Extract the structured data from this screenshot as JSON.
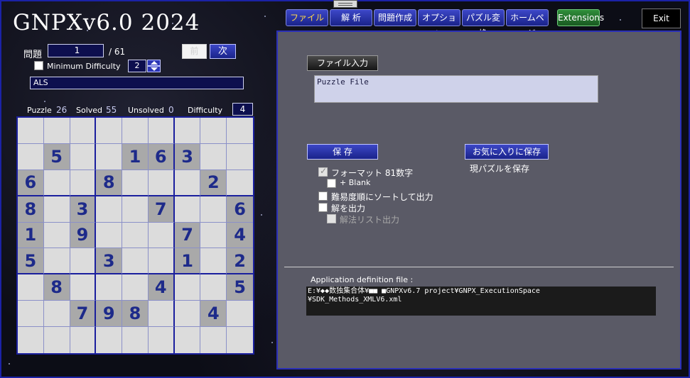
{
  "app": {
    "title": "GNPXv6.0 2024"
  },
  "nav": {
    "tabs": [
      "ファイル",
      "解 析",
      "問題作成",
      "オプション",
      "パズル変換",
      "ホームページ"
    ],
    "active": "ファイル",
    "extensions": "Extensions",
    "exit": "Exit"
  },
  "problem": {
    "label": "問題",
    "number": "1",
    "total": "/ 61",
    "prev": "前",
    "next": "次"
  },
  "min_difficulty": {
    "label": "Minimum Difficulty",
    "checked": false,
    "value": "2"
  },
  "method_name": "ALS",
  "stats": {
    "puzzle_label": "Puzzle",
    "puzzle_value": "26",
    "solved_label": "Solved",
    "solved_value": "55",
    "unsolved_label": "Unsolved",
    "unsolved_value": "0",
    "difficulty_label": "Difficulty",
    "difficulty_value": "4"
  },
  "board": [
    [
      "",
      "",
      "",
      "",
      "",
      "",
      "",
      "",
      ""
    ],
    [
      "",
      "5",
      "",
      "",
      "1",
      "6",
      "3",
      "",
      ""
    ],
    [
      "6",
      "",
      "",
      "8",
      "",
      "",
      "",
      "2",
      ""
    ],
    [
      "8",
      "",
      "3",
      "",
      "",
      "7",
      "",
      "",
      "6"
    ],
    [
      "1",
      "",
      "9",
      "",
      "",
      "",
      "7",
      "",
      "4"
    ],
    [
      "5",
      "",
      "",
      "3",
      "",
      "",
      "1",
      "",
      "2"
    ],
    [
      "",
      "8",
      "",
      "",
      "",
      "4",
      "",
      "",
      "5"
    ],
    [
      "",
      "",
      "7",
      "9",
      "8",
      "",
      "",
      "4",
      ""
    ],
    [
      "",
      "",
      "",
      "",
      "",
      "",
      "",
      "",
      ""
    ]
  ],
  "file_panel": {
    "file_input_button": "ファイル入力",
    "file_area_text": "Puzzle File",
    "save_button": "保 存",
    "favorite_button": "お気に入りに保存",
    "favorite_desc": "現パズルを保存",
    "options": {
      "format81": {
        "label": "フォーマット 81数字",
        "checked": true,
        "disabled": true
      },
      "blank": {
        "label": "+ Blank",
        "checked": false,
        "disabled": false
      },
      "sort_by_difficulty": {
        "label": "難易度順にソートして出力",
        "checked": false,
        "disabled": false
      },
      "output_solution": {
        "label": "解を出力",
        "checked": false,
        "disabled": false
      },
      "method_list": {
        "label": "解法リスト出力",
        "checked": false,
        "disabled": true
      }
    },
    "app_def_label": "Application definition file :",
    "app_def_path_line1": "E:¥◆◆数独集合体¥■■ ■GNPXv6.7 project¥GNPX_ExecutionSpace",
    "app_def_path_line2": "¥SDK_Methods_XMLV6.xml"
  }
}
